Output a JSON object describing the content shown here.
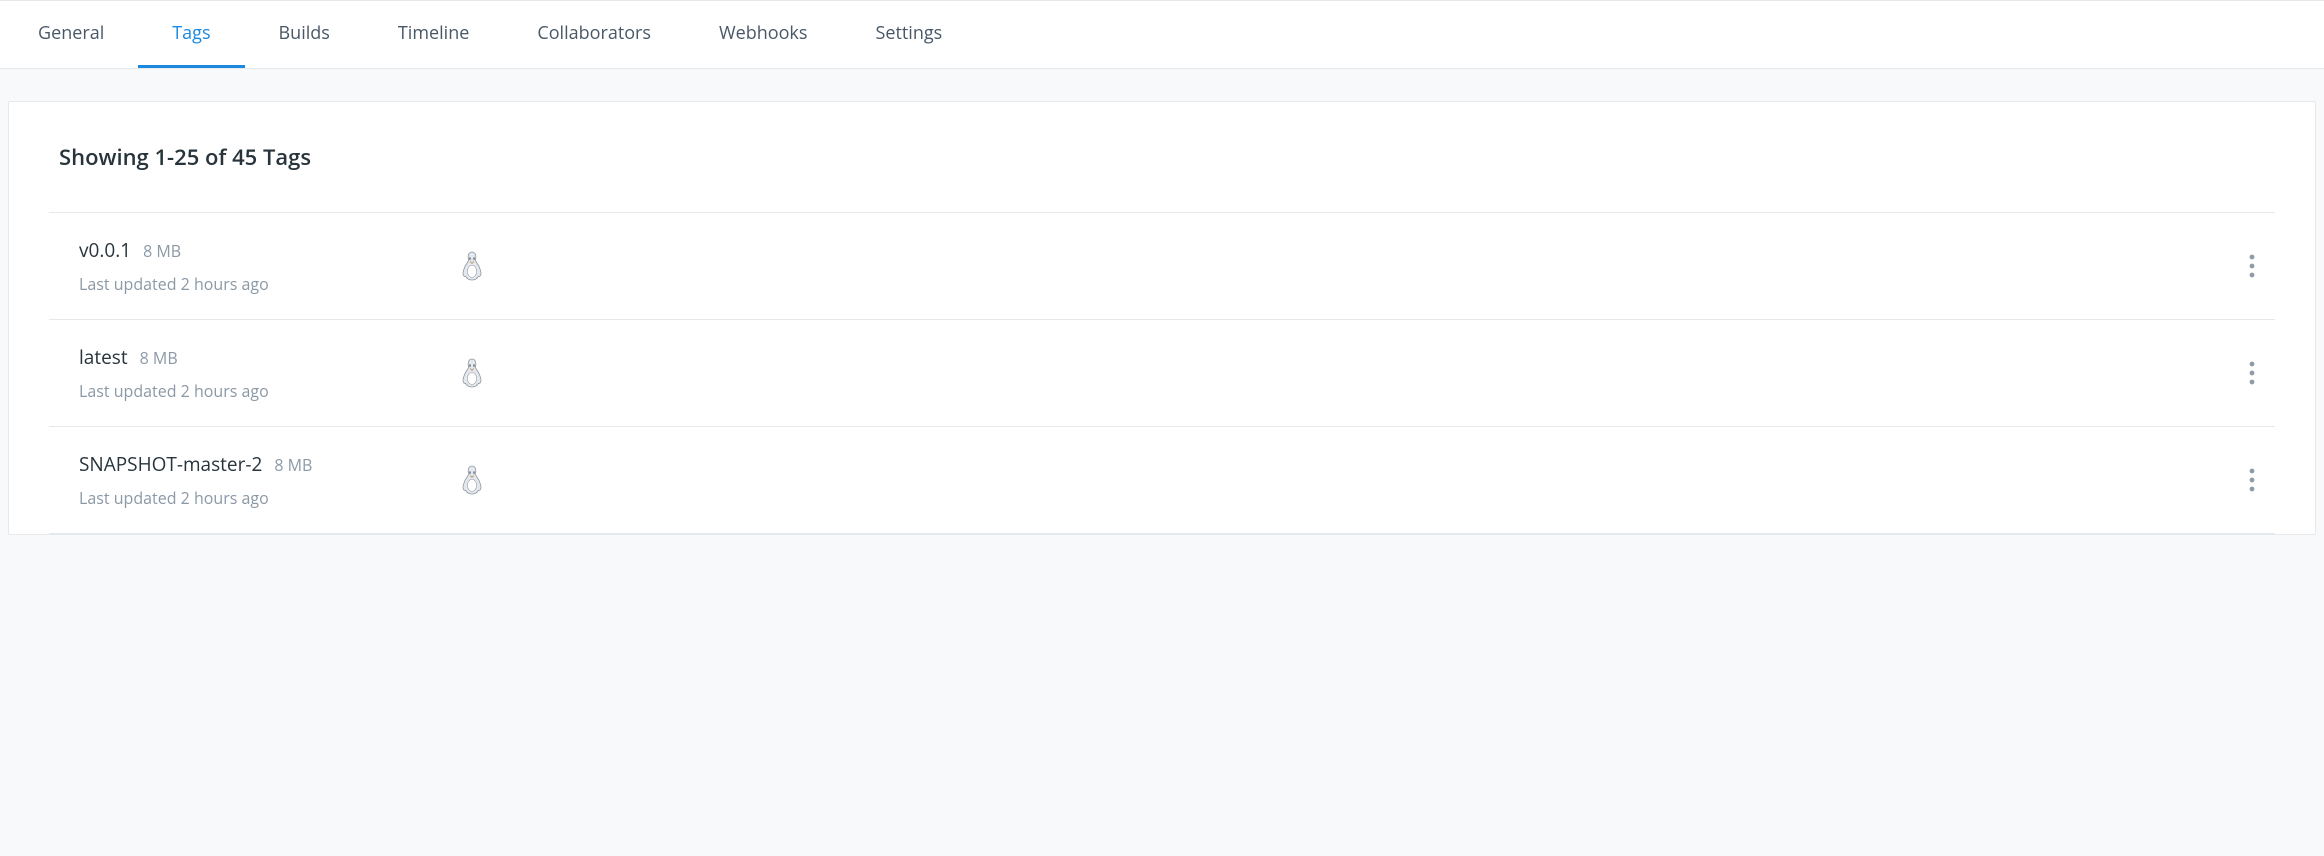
{
  "tabs": [
    {
      "label": "General",
      "active": false
    },
    {
      "label": "Tags",
      "active": true
    },
    {
      "label": "Builds",
      "active": false
    },
    {
      "label": "Timeline",
      "active": false
    },
    {
      "label": "Collaborators",
      "active": false
    },
    {
      "label": "Webhooks",
      "active": false
    },
    {
      "label": "Settings",
      "active": false
    }
  ],
  "panel": {
    "title": "Showing 1-25 of 45 Tags"
  },
  "tags": [
    {
      "name": "v0.0.1",
      "size": "8 MB",
      "updated": "Last updated 2 hours ago",
      "os": "linux"
    },
    {
      "name": "latest",
      "size": "8 MB",
      "updated": "Last updated 2 hours ago",
      "os": "linux"
    },
    {
      "name": "SNAPSHOT-master-2",
      "size": "8 MB",
      "updated": "Last updated 2 hours ago",
      "os": "linux"
    }
  ]
}
